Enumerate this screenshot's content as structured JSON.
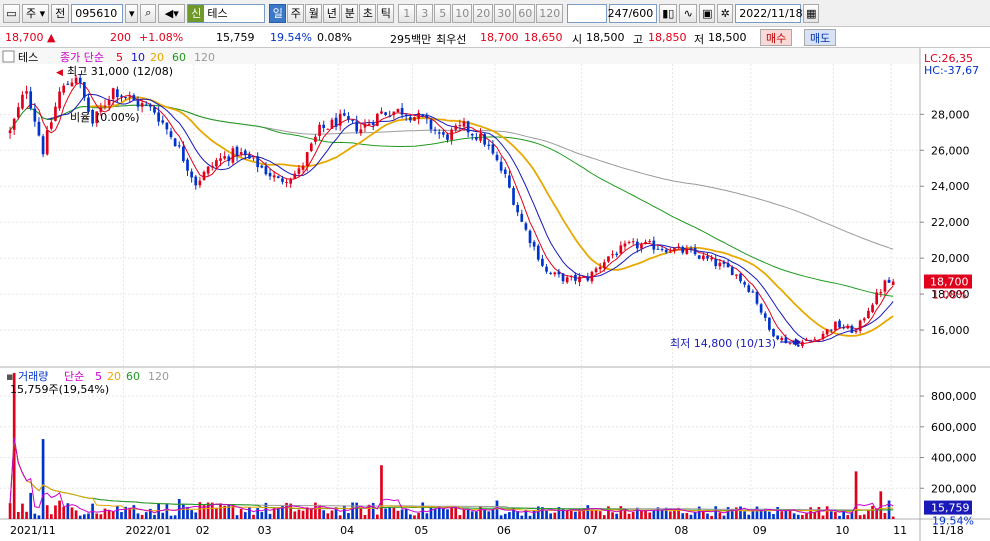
{
  "toolbar": {
    "market": "주",
    "market_btn": "전",
    "code": "095610",
    "stock_badge": "신",
    "stock_name": "테스",
    "periods": [
      "일",
      "주",
      "월",
      "년",
      "분",
      "초",
      "틱"
    ],
    "selected_period": "일",
    "intervals": [
      "1",
      "3",
      "5",
      "10",
      "20",
      "30",
      "60",
      "120"
    ],
    "count": "247",
    "count_total": "/600",
    "date": "2022/11/18"
  },
  "quote": {
    "price": "18,700",
    "change": "200",
    "change_pct": "+1.08%",
    "volume": "15,759",
    "volume_pct": "19.54%",
    "turnover": "0.08%",
    "amount": "295백만",
    "best_label": "최우선",
    "best_ask": "18,700",
    "best_bid": "18,650",
    "open_label": "시",
    "open": "18,500",
    "high_label": "고",
    "high": "18,850",
    "low_label": "저",
    "low": "18,500",
    "buy_label": "매수",
    "sell_label": "매도"
  },
  "colors": {
    "up": "#e0001b",
    "down": "#0033cc",
    "ma5": "#e0001b",
    "ma10": "#1a1ab8",
    "ma20": "#e8a800",
    "ma60": "#1f9a1f",
    "ma120": "#9a9a9a"
  },
  "chart_data": [
    {
      "type": "candlestick",
      "panel_label": "테스",
      "legend": {
        "prefix": "종가 단순",
        "periods": [
          "5",
          "10",
          "20",
          "60",
          "120"
        ]
      },
      "header_right": [
        "LC:26,35",
        "HC:-37,67"
      ],
      "annotations": {
        "high": "최고 31,000 (12/08)",
        "low": "최저 14,800 (10/13)",
        "ratio": "비율",
        "ratio_value": "(0.00%)"
      },
      "y_ticks": [
        16000,
        18000,
        20000,
        22000,
        24000,
        26000,
        28000
      ],
      "y_tick_labels": [
        "16,000",
        "18,000",
        "20,000",
        "22,000",
        "24,000",
        "26,000",
        "28,000"
      ],
      "ylim": [
        14000,
        30800
      ],
      "last_price_label": "18,700",
      "last_change_label": "1.08%",
      "keypoints": [
        [
          0,
          27000
        ],
        [
          4,
          29500
        ],
        [
          8,
          26000
        ],
        [
          12,
          29200
        ],
        [
          16,
          30200
        ],
        [
          20,
          27500
        ],
        [
          25,
          29400
        ],
        [
          30,
          28700
        ],
        [
          35,
          28200
        ],
        [
          40,
          26500
        ],
        [
          45,
          24200
        ],
        [
          50,
          25400
        ],
        [
          55,
          25900
        ],
        [
          60,
          25200
        ],
        [
          65,
          24300
        ],
        [
          70,
          24800
        ],
        [
          75,
          27100
        ],
        [
          80,
          27700
        ],
        [
          85,
          27200
        ],
        [
          90,
          28100
        ],
        [
          95,
          28200
        ],
        [
          100,
          27700
        ],
        [
          105,
          26700
        ],
        [
          110,
          27300
        ],
        [
          115,
          26500
        ],
        [
          120,
          24500
        ],
        [
          124,
          22000
        ],
        [
          130,
          19200
        ],
        [
          135,
          18800
        ],
        [
          140,
          18900
        ],
        [
          145,
          20100
        ],
        [
          150,
          20700
        ],
        [
          155,
          20700
        ],
        [
          160,
          20500
        ],
        [
          165,
          20300
        ],
        [
          170,
          19800
        ],
        [
          175,
          19300
        ],
        [
          180,
          18100
        ],
        [
          184,
          16000
        ],
        [
          187,
          15500
        ],
        [
          190,
          15200
        ],
        [
          195,
          15500
        ],
        [
          200,
          16300
        ],
        [
          205,
          15900
        ],
        [
          208,
          17200
        ],
        [
          212,
          18600
        ],
        [
          214,
          18700
        ]
      ]
    },
    {
      "type": "bar",
      "panel_label": "거래량",
      "legend": {
        "prefix": "단순",
        "periods": [
          "5",
          "20",
          "60",
          "120"
        ]
      },
      "current_label": "15,759주(19,54%)",
      "y_ticks": [
        200000,
        400000,
        600000,
        800000
      ],
      "y_tick_labels": [
        "200,000",
        "400,000",
        "600,000",
        "800,000"
      ],
      "ylim": [
        0,
        950000
      ],
      "last_volume_label": "15,759",
      "last_volume_pct": "19.54%",
      "spikes": [
        [
          1,
          950000
        ],
        [
          3,
          100000
        ],
        [
          5,
          170000
        ],
        [
          8,
          520000
        ],
        [
          12,
          120000
        ],
        [
          20,
          100000
        ],
        [
          30,
          90000
        ],
        [
          41,
          130000
        ],
        [
          90,
          350000
        ],
        [
          118,
          120000
        ],
        [
          140,
          90000
        ],
        [
          205,
          310000
        ],
        [
          211,
          180000
        ],
        [
          213,
          120000
        ]
      ],
      "x_labels": [
        "2021/11",
        "2022/01",
        "02",
        "03",
        "04",
        "05",
        "06",
        "07",
        "08",
        "09",
        "10",
        "11",
        "11/18"
      ],
      "x_label_idx": [
        0,
        28,
        45,
        60,
        80,
        98,
        118,
        139,
        161,
        180,
        200,
        214,
        220
      ]
    }
  ]
}
